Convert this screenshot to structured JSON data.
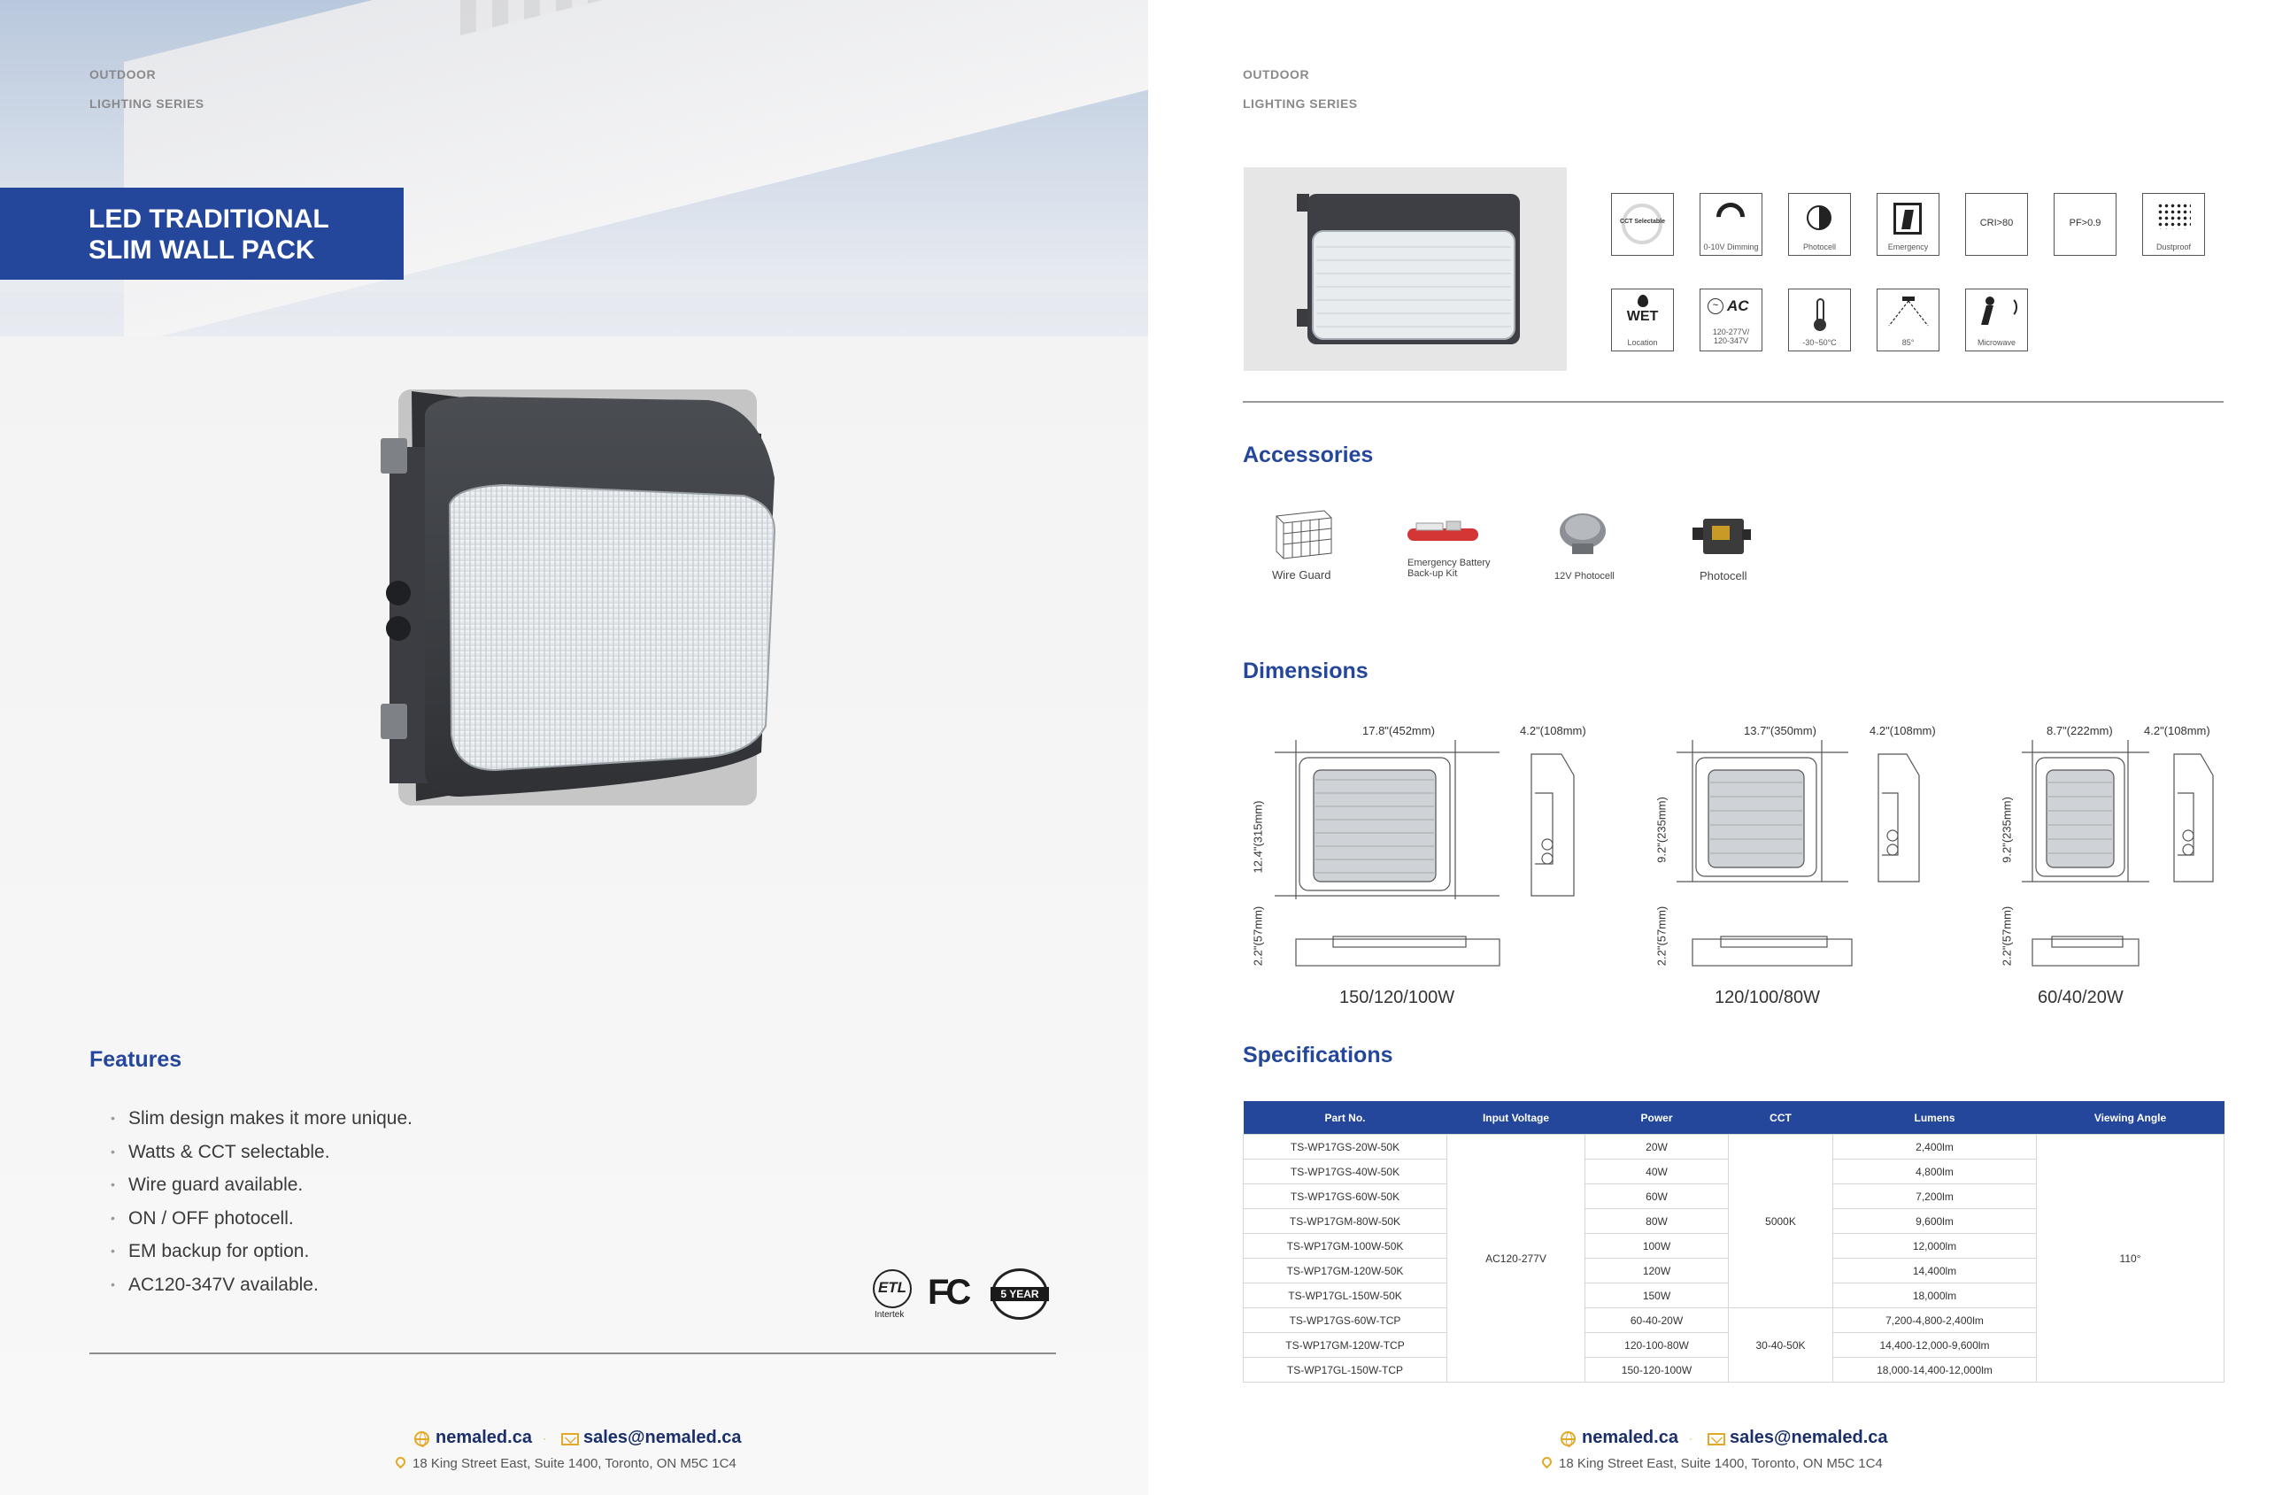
{
  "left": {
    "series_line1": "OUTDOOR",
    "series_line2": "LIGHTING SERIES",
    "title_line1": "LED TRADITIONAL",
    "title_line2": "SLIM WALL PACK",
    "features_title": "Features",
    "features": [
      "Slim design makes it more unique.",
      "Watts &  CCT selectable.",
      "Wire guard available.",
      "ON / OFF photocell.",
      "EM backup for option.",
      "AC120-347V available."
    ],
    "cert_labels": {
      "intertek": "Intertek",
      "etl": "ETL",
      "fc": "FC",
      "warranty": "5 YEAR"
    }
  },
  "right": {
    "series_line1": "OUTDOOR",
    "series_line2": "LIGHTING SERIES",
    "icons_row1": [
      {
        "name": "cct-selectable-icon",
        "label": "CCT Selectable",
        "caption": ""
      },
      {
        "name": "dimming-icon",
        "label": "",
        "caption": "0-10V Dimming"
      },
      {
        "name": "photocell-icon",
        "label": "",
        "caption": "Photocell"
      },
      {
        "name": "emergency-icon",
        "label": "",
        "caption": "Emergency"
      },
      {
        "name": "cri-icon",
        "label": "CRI>80",
        "caption": ""
      },
      {
        "name": "pf-icon",
        "label": "PF>0.9",
        "caption": ""
      },
      {
        "name": "dustproof-icon",
        "label": "",
        "caption": "Dustproof"
      }
    ],
    "icons_row2": [
      {
        "name": "wet-location-icon",
        "label": "WET",
        "caption": "Location"
      },
      {
        "name": "ac-voltage-icon",
        "label": "AC",
        "caption": "120-277V/ 120-347V"
      },
      {
        "name": "temperature-icon",
        "label": "",
        "caption": "-30~50°C"
      },
      {
        "name": "beam-angle-icon",
        "label": "",
        "caption": "85°"
      },
      {
        "name": "microwave-icon",
        "label": "",
        "caption": "Microwave"
      }
    ],
    "accessories_title": "Accessories",
    "accessories": [
      {
        "label": "Wire Guard"
      },
      {
        "label": "Emergency Battery Back-up Kit"
      },
      {
        "label": "12V Photocell"
      },
      {
        "label": "Photocell"
      }
    ],
    "dimensions_title": "Dimensions",
    "dimension_groups": [
      {
        "width": "17.8\"(452mm)",
        "depth": "4.2\"(108mm)",
        "height": "12.4\"(315mm)",
        "side": "2.2\"(57mm)",
        "label": "150/120/100W"
      },
      {
        "width": "13.7\"(350mm)",
        "depth": "4.2\"(108mm)",
        "height": "9.2\"(235mm)",
        "side": "2.2\"(57mm)",
        "label": "120/100/80W"
      },
      {
        "width": "8.7\"(222mm)",
        "depth": "4.2\"(108mm)",
        "height": "9.2\"(235mm)",
        "side": "2.2\"(57mm)",
        "label": "60/40/20W"
      }
    ],
    "specs_title": "Specifications",
    "table": {
      "headers": [
        "Part No.",
        "Input Voltage",
        "Power",
        "CCT",
        "Lumens",
        "Viewing Angle"
      ],
      "input_voltage": "AC120-277V",
      "cct_fixed": "5000K",
      "cct_selectable": "30-40-50K",
      "viewing_angle": "110°",
      "rows": [
        {
          "part": "TS-WP17GS-20W-50K",
          "power": "20W",
          "lumens": "2,400lm"
        },
        {
          "part": "TS-WP17GS-40W-50K",
          "power": "40W",
          "lumens": "4,800lm"
        },
        {
          "part": "TS-WP17GS-60W-50K",
          "power": "60W",
          "lumens": "7,200lm"
        },
        {
          "part": "TS-WP17GM-80W-50K",
          "power": "80W",
          "lumens": "9,600lm"
        },
        {
          "part": "TS-WP17GM-100W-50K",
          "power": "100W",
          "lumens": "12,000lm"
        },
        {
          "part": "TS-WP17GM-120W-50K",
          "power": "120W",
          "lumens": "14,400lm"
        },
        {
          "part": "TS-WP17GL-150W-50K",
          "power": "150W",
          "lumens": "18,000lm"
        },
        {
          "part": "TS-WP17GS-60W-TCP",
          "power": "60-40-20W",
          "lumens": "7,200-4,800-2,400lm"
        },
        {
          "part": "TS-WP17GM-120W-TCP",
          "power": "120-100-80W",
          "lumens": "14,400-12,000-9,600lm"
        },
        {
          "part": "TS-WP17GL-150W-TCP",
          "power": "150-120-100W",
          "lumens": "18,000-14,400-12,000lm"
        }
      ]
    }
  },
  "footer": {
    "website": "nemaled.ca",
    "email": "sales@nemaled.ca",
    "address": "18 King Street East, Suite 1400, Toronto, ON M5C 1C4",
    "separator": "·"
  },
  "colors": {
    "brand_blue": "#24479b",
    "accent_gold": "#e3a826",
    "dark_navy": "#1b2f6b"
  }
}
